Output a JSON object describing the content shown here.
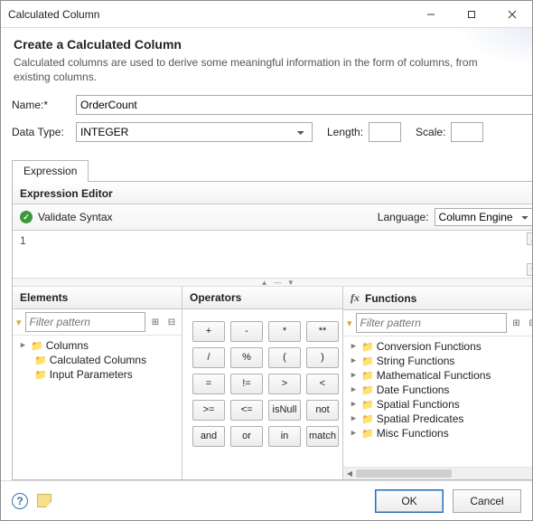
{
  "window": {
    "title": "Calculated Column"
  },
  "header": {
    "heading": "Create a Calculated Column",
    "description": "Calculated columns are used to derive some meaningful information in the form of columns, from existing columns."
  },
  "form": {
    "name_label": "Name:*",
    "name_value": "OrderCount",
    "datatype_label": "Data Type:",
    "datatype_value": "INTEGER",
    "length_label": "Length:",
    "length_value": "",
    "scale_label": "Scale:",
    "scale_value": ""
  },
  "tabs": {
    "expression": "Expression"
  },
  "expression": {
    "editor_title": "Expression Editor",
    "validate_label": "Validate Syntax",
    "language_label": "Language:",
    "language_value": "Column Engine",
    "content": "1"
  },
  "elements": {
    "title": "Elements",
    "filter_placeholder": "Filter pattern",
    "tree": {
      "root": "Columns",
      "calc": "Calculated Columns",
      "input": "Input Parameters"
    }
  },
  "operators": {
    "title": "Operators",
    "rows": [
      [
        "+",
        "-",
        "*",
        "**"
      ],
      [
        "/",
        "%",
        "(",
        ")"
      ],
      [
        "=",
        "!=",
        ">",
        "<"
      ],
      [
        ">=",
        "<=",
        "isNull",
        "not"
      ],
      [
        "and",
        "or",
        "in",
        "match"
      ]
    ]
  },
  "functions": {
    "title": "Functions",
    "filter_placeholder": "Filter pattern",
    "items": [
      "Conversion Functions",
      "String Functions",
      "Mathematical Functions",
      "Date Functions",
      "Spatial Functions",
      "Spatial Predicates",
      "Misc Functions"
    ]
  },
  "buttons": {
    "ok": "OK",
    "cancel": "Cancel"
  }
}
